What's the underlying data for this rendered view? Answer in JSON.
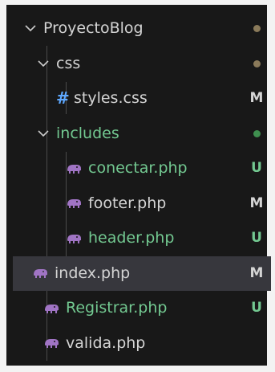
{
  "explorer": {
    "root": {
      "label": "ProyectoBlog",
      "dot_color": "#8a7a5a"
    },
    "css_folder": {
      "label": "css",
      "dot_color": "#8a7a5a"
    },
    "styles_file": {
      "icon": "#",
      "label": "styles.css",
      "badge": "M"
    },
    "includes_folder": {
      "label": "includes",
      "dot_color": "#3f8f4f"
    },
    "conectar_file": {
      "label": "conectar.php",
      "badge": "U"
    },
    "footer_file": {
      "label": "footer.php",
      "badge": "M"
    },
    "header_file": {
      "label": "header.php",
      "badge": "U"
    },
    "index_file": {
      "label": "index.php",
      "badge": "M"
    },
    "registrar_file": {
      "label": "Registrar.php",
      "badge": "U"
    },
    "valida_file": {
      "label": "valida.php"
    }
  },
  "colors": {
    "modified": "#e2c08d",
    "modified_text": "#d4d4d4",
    "untracked": "#73c991",
    "php_icon": "#a074c4",
    "css_icon": "#5ea8ff",
    "selected_bg": "#37373d"
  }
}
